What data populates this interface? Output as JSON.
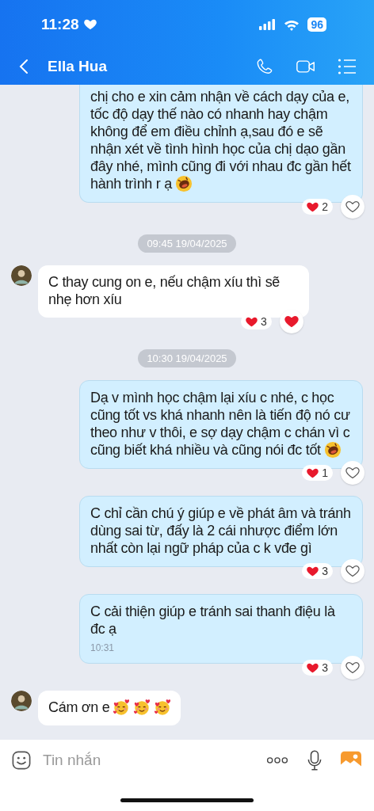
{
  "status_bar": {
    "time": "11:28",
    "battery": "96"
  },
  "header": {
    "title": "Ella Hua"
  },
  "messages": [
    {
      "kind": "sent",
      "text": "chị cho e xin cảm nhận về cách dạy của e, tốc độ dạy thế nào có nhanh hay chậm không để em điều chỉnh ạ,sau đó e sẽ nhận xét về tình hình học của chị dạo gần đây nhé, mình cũng đi với nhau đc gần hết hành trình r ạ",
      "emojis": [
        {
          "kind": "laughing"
        }
      ],
      "reaction_count": "2",
      "liked": false
    },
    {
      "kind": "time",
      "text": "09:45 19/04/2025"
    },
    {
      "kind": "received",
      "text": "C thay cung on e, nếu chậm xíu thì sẽ nhẹ hơn xíu",
      "reaction_count": "3",
      "liked": true
    },
    {
      "kind": "time",
      "text": "10:30 19/04/2025"
    },
    {
      "kind": "sent",
      "text": "Dạ v mình học chậm lại xíu c nhé, c học cũng tốt vs khá nhanh nên là tiến độ nó cư theo như v thôi, e sợ dạy chậm c chán vì c cũng biết khá nhiều và cũng nói đc tốt",
      "emojis": [
        {
          "kind": "laughing"
        }
      ],
      "reaction_count": "1",
      "liked": false
    },
    {
      "kind": "sent",
      "text": "C chỉ cần chú ý giúp e về phát âm và tránh dùng sai từ, đấy là 2 cái nhược điểm lớn nhất còn lại ngữ pháp của c k vđe gì",
      "reaction_count": "3",
      "liked": false
    },
    {
      "kind": "sent",
      "text": "C cải thiện giúp e tránh sai thanh điệu là đc ạ",
      "time": "10:31",
      "reaction_count": "3",
      "liked": false
    },
    {
      "kind": "received",
      "text": "Cám ơn e",
      "emojis": [
        {
          "kind": "smiling-hearts"
        },
        {
          "kind": "smiling-hearts"
        },
        {
          "kind": "smiling-hearts"
        }
      ]
    }
  ],
  "composer": {
    "placeholder": "Tin nhắn"
  }
}
